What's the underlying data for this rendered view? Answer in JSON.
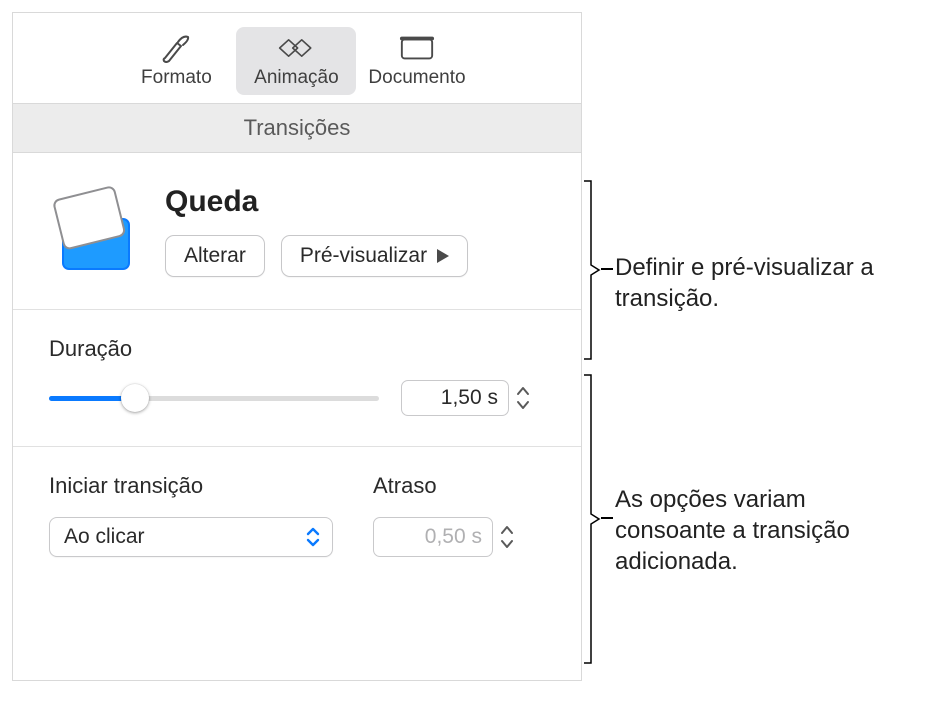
{
  "toolbar": {
    "format_label": "Formato",
    "animate_label": "Animação",
    "document_label": "Documento"
  },
  "subheader": {
    "title": "Transições"
  },
  "preview": {
    "transition_name": "Queda",
    "change_label": "Alterar",
    "preview_label": "Pré-visualizar"
  },
  "duration": {
    "label": "Duração",
    "value": "1,50 s",
    "slider_percent": 26
  },
  "start": {
    "label": "Iniciar transição",
    "selected": "Ao clicar"
  },
  "delay": {
    "label": "Atraso",
    "value": "0,50 s"
  },
  "callouts": {
    "top": "Definir e pré-visualizar a transição.",
    "bottom": "As opções variam consoante a transição adicionada."
  }
}
